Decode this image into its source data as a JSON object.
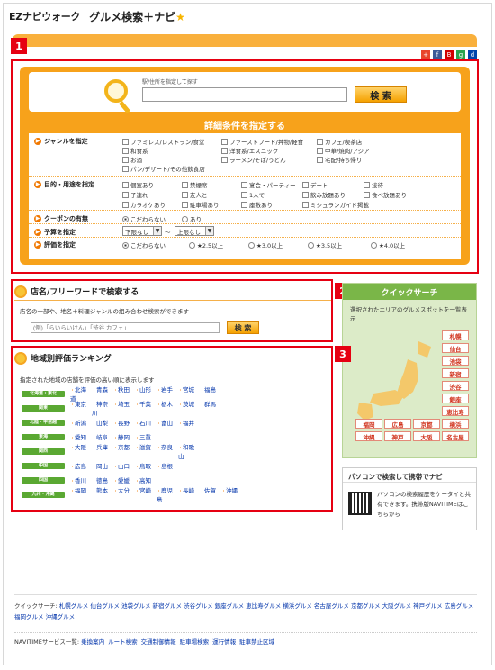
{
  "header": {
    "brand": "EZナビウォーク",
    "service": "グルメ検索＋ナビ"
  },
  "annotations": [
    "1",
    "2",
    "3"
  ],
  "search": {
    "hint": "駅/住所を指定して探す",
    "input_value": "",
    "button": "検 索",
    "detail_title": "詳細条件を指定する",
    "genre_label": "ジャンルを指定",
    "genres": [
      "ファミレス/レストラン/食堂",
      "ファーストフード/丼物/軽食",
      "カフェ/喫茶店",
      "和食系",
      "洋食系/エスニック",
      "中華/焼肉/アジア",
      "お酒",
      "ラーメン/そば/うどん",
      "宅配/持ち帰り",
      "パン/デザート/その他飲食店"
    ],
    "purpose_label": "目的・用途を指定",
    "purposes": [
      "個室あり",
      "禁煙席",
      "宴会・パーティー",
      "デート",
      "接待",
      "子連れ",
      "友人と",
      "1人で",
      "飲み放題あり",
      "食べ放題あり",
      "カラオケあり",
      "駐車場あり",
      "座敷あり",
      "ミシュランガイド掲載"
    ],
    "coupon_label": "クーポンの有無",
    "coupon_options": [
      "こだわらない",
      "あり"
    ],
    "budget_label": "予算を指定",
    "budget_from": "下限なし",
    "budget_sep": "〜",
    "budget_to": "上限なし",
    "rating_label": "評価を指定",
    "rating_options": [
      "こだわらない",
      "★2.5以上",
      "★3.0以上",
      "★3.5以上",
      "★4.0以上"
    ]
  },
  "name_search": {
    "title": "店名/フリーワードで検索する",
    "description": "店名の一部や、地名＋料理ジャンルの組み合わせ検索ができます",
    "placeholder": "(例)「らいらいけん」「渋谷 カフェ」",
    "button": "検 索"
  },
  "ranking": {
    "title": "地域別評価ランキング",
    "description": "指定された地域の店舗を評価の高い順に表示します",
    "regions": [
      {
        "name": "北海道・東北",
        "links": [
          "北海道",
          "青森",
          "秋田",
          "山形",
          "岩手",
          "宮城",
          "福島"
        ]
      },
      {
        "name": "関東",
        "links": [
          "東京",
          "神奈川",
          "埼玉",
          "千葉",
          "栃木",
          "茨城",
          "群馬"
        ]
      },
      {
        "name": "北陸・甲信越",
        "links": [
          "新潟",
          "山梨",
          "長野",
          "石川",
          "富山",
          "福井"
        ]
      },
      {
        "name": "東海",
        "links": [
          "愛知",
          "岐阜",
          "静岡",
          "三重"
        ]
      },
      {
        "name": "関西",
        "links": [
          "大阪",
          "兵庫",
          "京都",
          "滋賀",
          "奈良",
          "和歌山"
        ]
      },
      {
        "name": "中国",
        "links": [
          "広島",
          "岡山",
          "山口",
          "鳥取",
          "島根"
        ]
      },
      {
        "name": "四国",
        "links": [
          "香川",
          "徳島",
          "愛媛",
          "高知"
        ]
      },
      {
        "name": "九州・沖縄",
        "links": [
          "福岡",
          "熊本",
          "大分",
          "宮崎",
          "鹿児島",
          "長崎",
          "佐賀",
          "沖縄"
        ]
      }
    ]
  },
  "quick": {
    "title": "クイックサーチ",
    "description": "選択されたエリアのグルメスポットを一覧表示",
    "cities_right": [
      "札幌",
      "仙台",
      "池袋",
      "新宿",
      "渋谷",
      "銀座",
      "恵比寿"
    ],
    "cities_bottom": [
      "福岡",
      "広島",
      "京都",
      "横浜",
      "沖縄",
      "神戸",
      "大阪",
      "名古屋"
    ]
  },
  "pc": {
    "title": "パソコンで検索して携帯でナビ",
    "text": "パソコンの検索履歴をケータイと共有できます。携帯版NAVITIMEはこちらから"
  },
  "footer": {
    "quick_label": "クイックサーチ:",
    "quick_links": [
      "札幌グルメ",
      "仙台グルメ",
      "池袋グルメ",
      "新宿グルメ",
      "渋谷グルメ",
      "銀座グルメ",
      "恵比寿グルメ",
      "横浜グルメ",
      "名古屋グルメ",
      "京都グルメ",
      "大阪グルメ",
      "神戸グルメ",
      "広島グルメ",
      "福岡グルメ",
      "沖縄グルメ"
    ],
    "service_label": "NAVITIMEサービス一覧:",
    "service_links": [
      "乗換案内",
      "ルート検索",
      "交通制御情報",
      "駐車場検索",
      "運行情報",
      "駐車禁止区域"
    ]
  },
  "colors": {
    "accent": "#f7a21b",
    "annotation": "#e60012",
    "quick": "#7ab648"
  }
}
